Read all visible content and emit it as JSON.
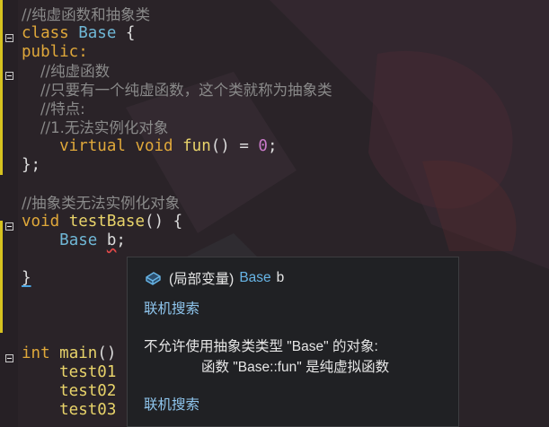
{
  "editor": {
    "lines": [
      [
        {
          "t": "//纯虚函数和抽象类",
          "c": "cm"
        }
      ],
      [
        {
          "t": "class ",
          "c": "kw"
        },
        {
          "t": "Base",
          "c": "ty"
        },
        {
          "t": " {",
          "c": "pl"
        }
      ],
      [
        {
          "t": "public:",
          "c": "kw"
        }
      ],
      [
        {
          "t": "    //纯虚函数",
          "c": "cm"
        }
      ],
      [
        {
          "t": "    //只要有一个纯虚函数，这个类就称为抽象类",
          "c": "cm"
        }
      ],
      [
        {
          "t": "    //特点:",
          "c": "cm"
        }
      ],
      [
        {
          "t": "    //1.无法实例化对象",
          "c": "cm"
        }
      ],
      [
        {
          "t": "    virtual ",
          "c": "kw"
        },
        {
          "t": "void ",
          "c": "kw"
        },
        {
          "t": "fun",
          "c": "fn"
        },
        {
          "t": "() = ",
          "c": "pl"
        },
        {
          "t": "0",
          "c": "num"
        },
        {
          "t": ";",
          "c": "pl"
        }
      ],
      [
        {
          "t": "};",
          "c": "pl"
        }
      ],
      [],
      [
        {
          "t": "//抽象类无法实例化对象",
          "c": "cm"
        }
      ],
      [
        {
          "t": "void ",
          "c": "kw"
        },
        {
          "t": "testBase",
          "c": "fn"
        },
        {
          "t": "() {",
          "c": "pl"
        }
      ],
      [
        {
          "t": "    ",
          "c": "pl"
        },
        {
          "t": "Base",
          "c": "ty"
        },
        {
          "t": " ",
          "c": "pl"
        },
        {
          "t": "b",
          "c": "pl squig"
        },
        {
          "t": ";",
          "c": "pl"
        }
      ],
      [],
      [
        {
          "t": "}",
          "c": "pl caret-line"
        }
      ],
      [],
      [],
      [],
      [
        {
          "t": "int ",
          "c": "kw"
        },
        {
          "t": "main",
          "c": "fn"
        },
        {
          "t": "()",
          "c": "pl"
        }
      ],
      [
        {
          "t": "    test01",
          "c": "fn"
        }
      ],
      [
        {
          "t": "    test02",
          "c": "fn"
        }
      ],
      [
        {
          "t": "    test03",
          "c": "fn"
        }
      ]
    ]
  },
  "tooltip": {
    "kind": "(局部变量)",
    "type": "Base",
    "name": "b",
    "search_link_1": "联机搜索",
    "error_line1": "不允许使用抽象类类型 \"Base\" 的对象:",
    "error_line2": "函数 \"Base::fun\" 是纯虚拟函数",
    "search_link_2": "联机搜索",
    "icon": "local-variable-icon"
  }
}
